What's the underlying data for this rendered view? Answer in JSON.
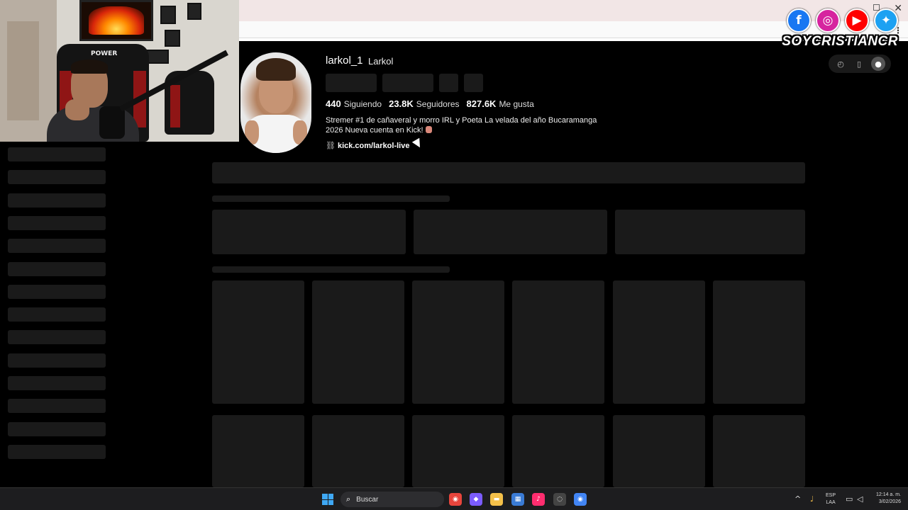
{
  "browser": {
    "close_glyph": "✕"
  },
  "overlay": {
    "brand": "SOYCRISTIANCR",
    "chair_brand": "POWER",
    "social_icons": [
      {
        "name": "facebook-icon",
        "glyph": "f",
        "color": "#1877f2"
      },
      {
        "name": "instagram-icon",
        "glyph": "◎",
        "color": "#d6249f"
      },
      {
        "name": "youtube-icon",
        "glyph": "▶",
        "color": "#ff0000"
      },
      {
        "name": "twitter-icon",
        "glyph": "✦",
        "color": "#1da1f2"
      }
    ]
  },
  "profile": {
    "username": "larkol_1",
    "display_name": "Larkol",
    "stats": {
      "following_count": "440",
      "following_label": "Siguiendo",
      "followers_count": "23.8K",
      "followers_label": "Seguidores",
      "likes_count": "827.6K",
      "likes_label": "Me gusta"
    },
    "bio_line1": "Stremer #1 de cañaveral y morro IRL y Poeta La velada del año Bucaramanga",
    "bio_line2": "2026 Nueva cuenta en Kick!",
    "link": "kick.com/larkol-live"
  },
  "tools": {
    "icon1": "◴",
    "icon2": "▯",
    "avatar_glyph": "●"
  },
  "taskbar": {
    "search_placeholder": "Buscar",
    "search_glyph": "⌕",
    "apps": [
      {
        "name": "chrome-icon",
        "glyph": "◉",
        "color": "#e8453c"
      },
      {
        "name": "copilot-icon",
        "glyph": "◆",
        "color": "#7b5cff"
      },
      {
        "name": "file-explorer-icon",
        "glyph": "▬",
        "color": "#f4c04a"
      },
      {
        "name": "store-icon",
        "glyph": "▦",
        "color": "#3a7bd5"
      },
      {
        "name": "tiktok-icon",
        "glyph": "♪",
        "color": "#ff2d6f"
      },
      {
        "name": "app-circle-icon",
        "glyph": "◌",
        "color": "#444"
      },
      {
        "name": "chrome-active-icon",
        "glyph": "◉",
        "color": "#4285f4"
      }
    ],
    "lang_top": "ESP",
    "lang_bottom": "LAA",
    "time": "12:14 a. m.",
    "date": "3/02/2026",
    "chevron_glyph": "^",
    "mic_glyph": "♩",
    "monitor_glyph": "▭",
    "speaker_glyph": "◁"
  },
  "colors": {
    "background": "#000000",
    "skeleton": "#1a1a1a",
    "taskbar": "#1d1d1f"
  }
}
